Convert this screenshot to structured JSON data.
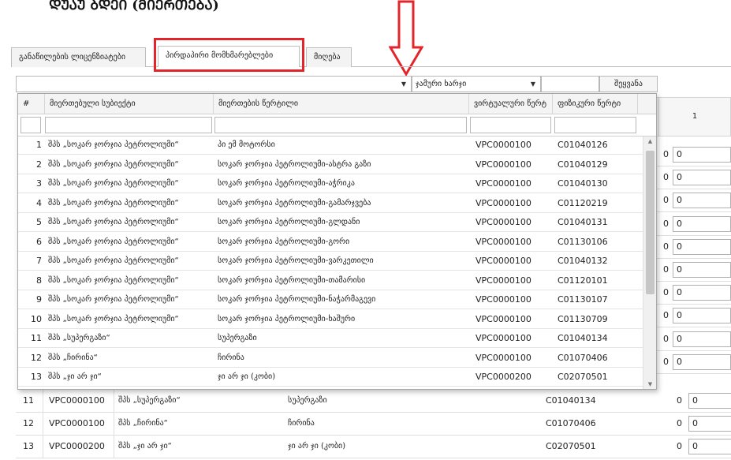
{
  "heading": "ᲓᲣᲐᲣ ᲑᲓᲔᲘ (ᲛᲘᲔᲠᲗᲔᲑᲐ)",
  "tabs": [
    {
      "label": "განაწილების ლიცენზიატები",
      "active": false
    },
    {
      "label": "პირდაპირი მომხმარებლები",
      "active": true
    },
    {
      "label": "მიღება",
      "active": false
    }
  ],
  "toolbar": {
    "combo1_value": "",
    "combo2_value": "ჯამური ხარჯი",
    "combo3_value": "",
    "add_button": "შეყვანა"
  },
  "background_table": {
    "column_header": "1",
    "rows": [
      {
        "n": "11",
        "vpc": "VPC0000100",
        "subject": "შპს „სუპერგაზი“",
        "point": "სუპერგაზი",
        "code": "C01040134",
        "zero": "0",
        "input": "0"
      },
      {
        "n": "12",
        "vpc": "VPC0000100",
        "subject": "შპს „ჩირინა“",
        "point": "ჩირინა",
        "code": "C01070406",
        "zero": "0",
        "input": "0"
      },
      {
        "n": "13",
        "vpc": "VPC0000200",
        "subject": "შპს „ჯი არ ჯი“",
        "point": "ჯი არ ჯი (კობი)",
        "code": "C02070501",
        "zero": "0",
        "input": "0"
      }
    ],
    "side_values": [
      "0",
      "0",
      "0",
      "0",
      "0",
      "0",
      "0",
      "0",
      "0",
      "0"
    ]
  },
  "dropdown": {
    "headers": [
      "#",
      "მიერთებული სუბიექტი",
      "მიერთების წერტილი",
      "ვირტუალური წერტ",
      "ფიზიკური წერტი"
    ],
    "rows": [
      {
        "n": "1",
        "subject": "შპს „სოკარ ჯორჯია პეტროლიუმი“",
        "point": "პი ემ მოტორსი",
        "virtual": "VPC0000100",
        "physical": "C01040126"
      },
      {
        "n": "2",
        "subject": "შპს „სოკარ ჯორჯია პეტროლიუმი“",
        "point": "სოკარ ჯორჯია პეტროლიუმი-ასტრა გაზი",
        "virtual": "VPC0000100",
        "physical": "C01040129"
      },
      {
        "n": "3",
        "subject": "შპს „სოკარ ჯორჯია პეტროლიუმი“",
        "point": "სოკარ ჯორჯია პეტროლიუმი-აჭრიკა",
        "virtual": "VPC0000100",
        "physical": "C01040130"
      },
      {
        "n": "4",
        "subject": "შპს „სოკარ ჯორჯია პეტროლიუმი“",
        "point": "სოკარ ჯორჯია პეტროლიუმი-გამარჯვება",
        "virtual": "VPC0000100",
        "physical": "C01120219"
      },
      {
        "n": "5",
        "subject": "შპს „სოკარ ჯორჯია პეტროლიუმი“",
        "point": "სოკარ ჯორჯია პეტროლიუმი-გლდანი",
        "virtual": "VPC0000100",
        "physical": "C01040131"
      },
      {
        "n": "6",
        "subject": "შპს „სოკარ ჯორჯია პეტროლიუმი“",
        "point": "სოკარ ჯორჯია პეტროლიუმი-გორი",
        "virtual": "VPC0000100",
        "physical": "C01130106"
      },
      {
        "n": "7",
        "subject": "შპს „სოკარ ჯორჯია პეტროლიუმი“",
        "point": "სოკარ ჯორჯია პეტროლიუმი-ვარკეთილი",
        "virtual": "VPC0000100",
        "physical": "C01040132"
      },
      {
        "n": "8",
        "subject": "შპს „სოკარ ჯორჯია პეტროლიუმი“",
        "point": "სოკარ ჯორჯია პეტროლიუმი-თამარისი",
        "virtual": "VPC0000100",
        "physical": "C01120101"
      },
      {
        "n": "9",
        "subject": "შპს „სოკარ ჯორჯია პეტროლიუმი“",
        "point": "სოკარ ჯორჯია პეტროლიუმი-ნაჭარმაგევი",
        "virtual": "VPC0000100",
        "physical": "C01130107"
      },
      {
        "n": "10",
        "subject": "შპს „სოკარ ჯორჯია პეტროლიუმი“",
        "point": "სოკარ ჯორჯია პეტროლიუმი-ხაშური",
        "virtual": "VPC0000100",
        "physical": "C01130709"
      },
      {
        "n": "11",
        "subject": "შპს „სუპერგაზი“",
        "point": "სუპერგაზი",
        "virtual": "VPC0000100",
        "physical": "C01040134"
      },
      {
        "n": "12",
        "subject": "შპს „ჩირინა“",
        "point": "ჩირინა",
        "virtual": "VPC0000100",
        "physical": "C01070406"
      },
      {
        "n": "13",
        "subject": "შპს „ჯი არ ჯი“",
        "point": "ჯი არ ჯი (კობი)",
        "virtual": "VPC0000200",
        "physical": "C02070501"
      }
    ]
  },
  "colors": {
    "highlight": "#e3242b",
    "header_bg": "#f4f4f4"
  }
}
